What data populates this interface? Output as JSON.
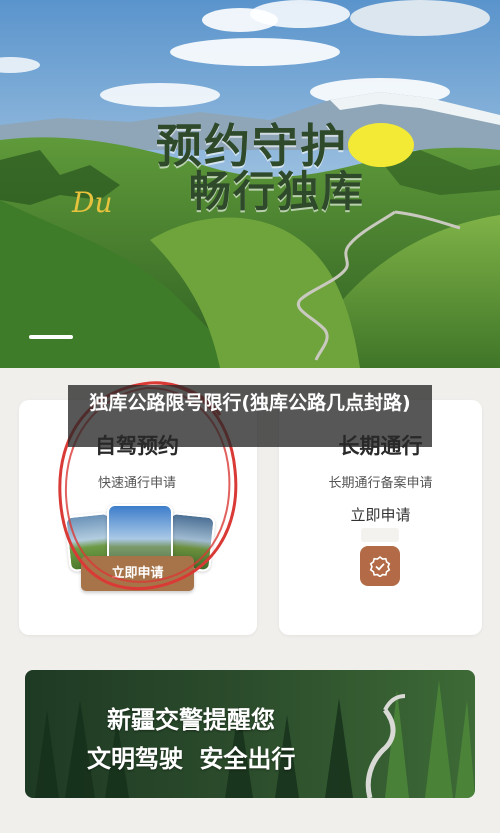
{
  "hero": {
    "line1": "预约守护",
    "line2": "畅行独库",
    "script_text": "Du",
    "colors": {
      "sky": "#6aa0d0",
      "grass": "#4f8a2f",
      "sun": "#f2ea34"
    }
  },
  "overlay": {
    "title": "独库公路限号限行(独库公路几点封路)"
  },
  "cards": {
    "self_drive": {
      "title": "自驾预约",
      "subtitle": "快速通行申请",
      "button": "立即申请"
    },
    "long_term": {
      "title": "长期通行",
      "subtitle": "长期通行备案申请",
      "action": "立即申请",
      "icon": "badge-check-icon"
    }
  },
  "banner": {
    "line1": "新疆交警提醒您",
    "line2": "文明驾驶 安全出行"
  },
  "colors": {
    "accent_brown": "#a7744a",
    "icon_brown": "#b26b46",
    "annotation_red": "#d93a36"
  }
}
